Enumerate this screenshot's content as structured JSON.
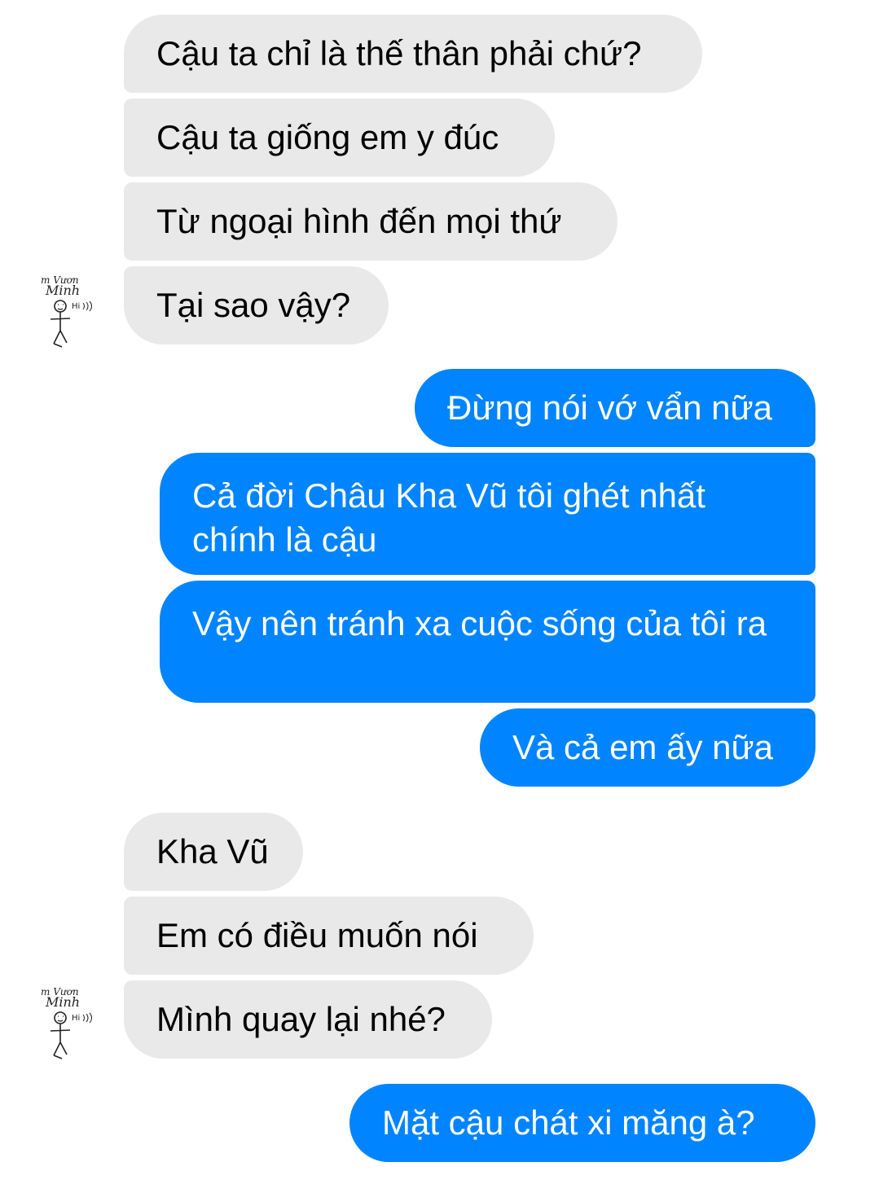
{
  "incoming_group_1": [
    "Cậu ta chỉ là thế thân phải chứ?",
    "Cậu ta giống em y đúc",
    "Từ ngoại hình đến mọi thứ",
    "Tại sao vậy?"
  ],
  "outgoing_group_1": [
    "Đừng nói vớ vẩn nữa",
    "Cả đời Châu Kha Vũ tôi ghét nhất chính là cậu",
    "Vậy nên tránh xa cuộc sống của tôi ra",
    "Và cả em ấy nữa"
  ],
  "incoming_group_2": [
    "Kha Vũ",
    "Em có điều muốn nói",
    "Mình quay lại nhé?"
  ],
  "outgoing_group_2": [
    "Mặt cậu chát xi măng à?"
  ],
  "avatar": {
    "icon": "stick-figure-doodle-icon",
    "line1": "m Vươn",
    "line2": "Minh",
    "line3": "Hi"
  },
  "colors": {
    "incoming_bubble": "#e9e9e9",
    "outgoing_bubble": "#0084ff",
    "outgoing_text": "#ffffff"
  }
}
